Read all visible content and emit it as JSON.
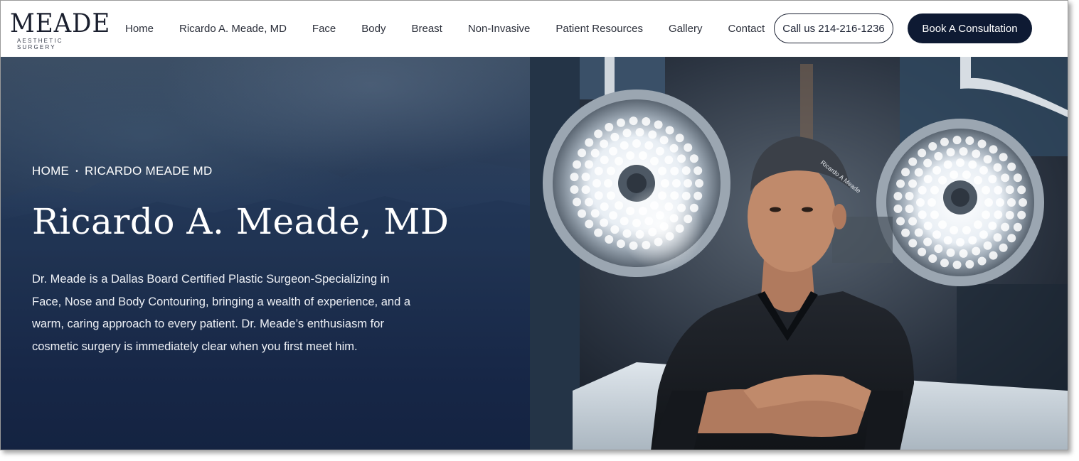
{
  "logo": {
    "word": "MEADE",
    "subtitle": "AESTHETIC SURGERY"
  },
  "nav": {
    "items": [
      "Home",
      "Ricardo A. Meade, MD",
      "Face",
      "Body",
      "Breast",
      "Non-Invasive",
      "Patient Resources",
      "Gallery",
      "Contact"
    ]
  },
  "actions": {
    "call_label": "Call us 214-216-1236",
    "book_label": "Book A Consultation"
  },
  "hero": {
    "breadcrumb": [
      "HOME",
      "RICARDO MEADE MD"
    ],
    "breadcrumb_separator": "•",
    "title": "Ricardo A. Meade, MD",
    "description": "Dr. Meade is a Dallas Board Certified Plastic Surgeon-Specializing in Face, Nose and Body Contouring, bringing a wealth of experience, and a warm, caring approach to every patient. Dr. Meade’s enthusiasm for cosmetic surgery is immediately clear when you first meet him.",
    "photo_cap_text": "Ricardo A Meade"
  },
  "colors": {
    "navy": "#0e1a33",
    "hero_bg": "#1e3150",
    "text_dark": "#2b2f3a"
  }
}
